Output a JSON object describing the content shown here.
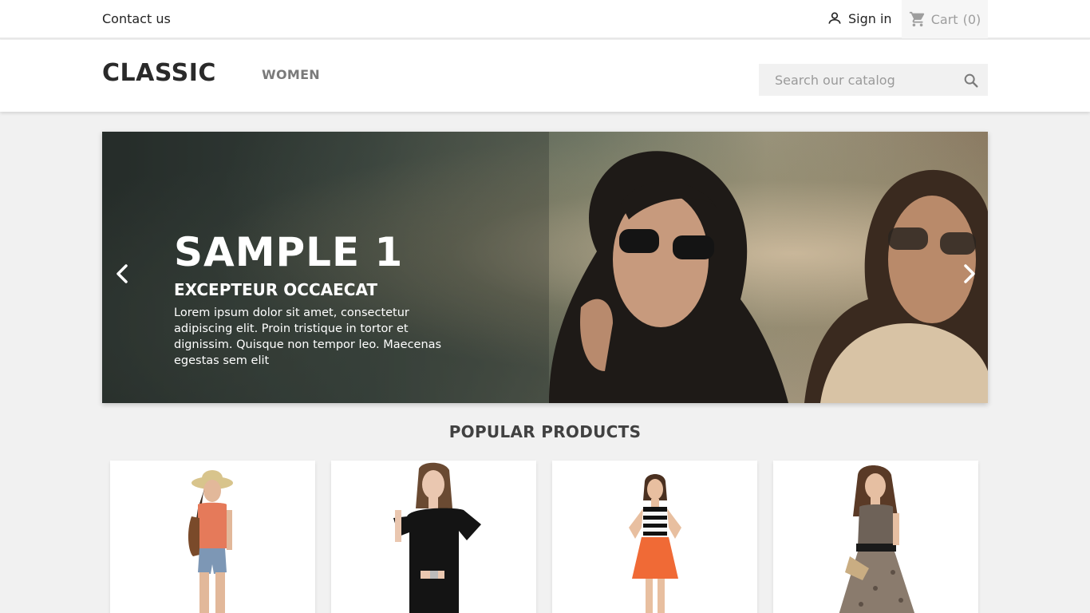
{
  "topbar": {
    "contact_label": "Contact us",
    "signin_label": "Sign in",
    "cart_label": "Cart",
    "cart_count": "(0)",
    "signin_icon": "user-icon",
    "cart_icon": "shopping-cart-icon"
  },
  "header": {
    "logo": "CLASSIC",
    "nav_women": "WOMEN",
    "search_placeholder": "Search our catalog",
    "search_icon": "search-icon"
  },
  "slider": {
    "title": "SAMPLE 1",
    "subtitle": "EXCEPTEUR OCCAECAT",
    "text": "Lorem ipsum dolor sit amet, consectetur adipiscing elit. Proin tristique in tortor et dignissim. Quisque non tempor leo. Maecenas egestas sem elit",
    "prev_icon": "chevron-left-icon",
    "next_icon": "chevron-right-icon"
  },
  "products": {
    "section_title": "POPULAR PRODUCTS"
  },
  "colors": {
    "background": "#f1f1f1",
    "header": "#ffffff",
    "cart_bg": "#f6f6f6",
    "text": "#232323"
  }
}
